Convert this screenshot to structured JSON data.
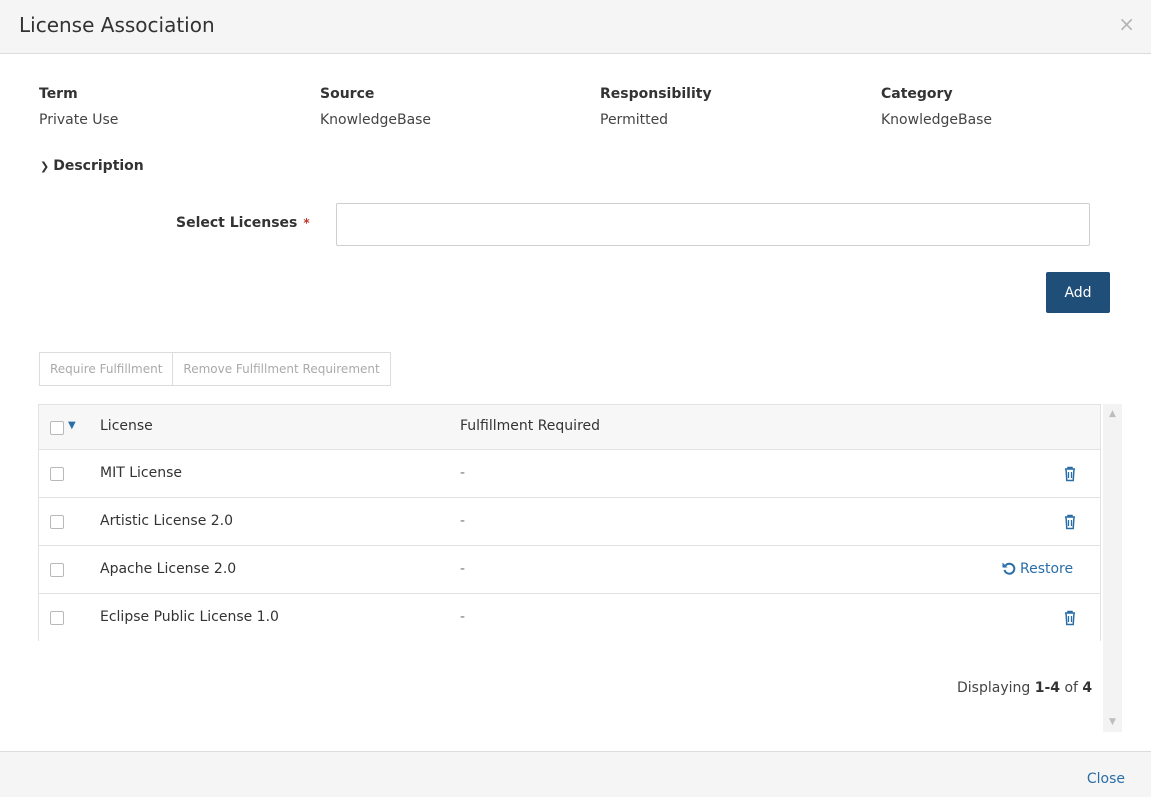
{
  "modal": {
    "title": "License Association",
    "close_symbol": "×"
  },
  "meta": [
    {
      "label": "Term",
      "value": "Private Use"
    },
    {
      "label": "Source",
      "value": "KnowledgeBase"
    },
    {
      "label": "Responsibility",
      "value": "Permitted"
    },
    {
      "label": "Category",
      "value": "KnowledgeBase"
    }
  ],
  "description_toggle": "Description",
  "select_licenses": {
    "label": "Select Licenses",
    "required_mark": "*",
    "value": "",
    "placeholder": ""
  },
  "add_label": "Add",
  "actions": {
    "require": "Require Fulfillment",
    "remove": "Remove Fulfillment Requirement"
  },
  "table": {
    "headers": {
      "license": "License",
      "fulfillment": "Fulfillment Required"
    },
    "rows": [
      {
        "license": "MIT License",
        "fulfillment": "-",
        "action": "trash-icon"
      },
      {
        "license": "Artistic License 2.0",
        "fulfillment": "-",
        "action": "trash-icon"
      },
      {
        "license": "Apache License 2.0",
        "fulfillment": "-",
        "action": "Restore"
      },
      {
        "license": "Eclipse Public License 1.0",
        "fulfillment": "-",
        "action": "trash-icon"
      }
    ]
  },
  "paging": {
    "prefix": "Displaying",
    "range": "1-4",
    "of_label": "of",
    "total": "4"
  },
  "footer": {
    "close_label": "Close"
  },
  "colors": {
    "primary": "#1f4e79",
    "link": "#2a6ea8",
    "required": "#c0392b"
  }
}
